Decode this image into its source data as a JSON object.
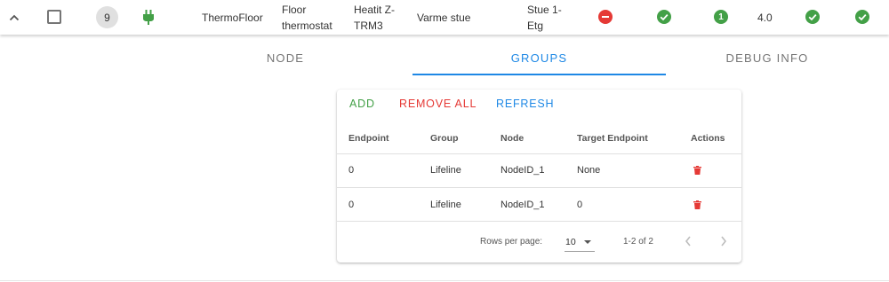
{
  "node": {
    "id": "9",
    "manufacturer": "ThermoFloor",
    "product": "Floor thermostat",
    "model": "Heatit Z-TRM3",
    "location_name": "Varme stue",
    "location_floor": "Stue 1-Etg",
    "status_count": "1",
    "firmware": "4.0",
    "colors": {
      "failed": "#e53935",
      "ok": "#43a047",
      "power": "#43a047"
    },
    "icons": [
      "chevron-up-icon",
      "checkbox-icon",
      "power-plug-icon",
      "failed-icon",
      "check-icon",
      "count-icon",
      "check-icon",
      "check-icon"
    ]
  },
  "tabs": [
    {
      "label": "NODE"
    },
    {
      "label": "GROUPS"
    },
    {
      "label": "DEBUG INFO"
    }
  ],
  "active_tab": "GROUPS",
  "accent_color": "#1e88e5",
  "groups": {
    "actions": {
      "add": "ADD",
      "remove_all": "REMOVE ALL",
      "refresh": "REFRESH"
    },
    "action_colors": {
      "add": "#43a047",
      "remove_all": "#e53935",
      "refresh": "#1e88e5"
    },
    "headers": [
      "Endpoint",
      "Group",
      "Node",
      "Target Endpoint",
      "Actions"
    ],
    "rows": [
      [
        "0",
        "Lifeline",
        "NodeID_1",
        "None"
      ],
      [
        "0",
        "Lifeline",
        "NodeID_1",
        "0"
      ]
    ],
    "pagination": {
      "rows_per_page_label": "Rows per page:",
      "rows_per_page": "10",
      "range": "1-2 of 2"
    }
  }
}
